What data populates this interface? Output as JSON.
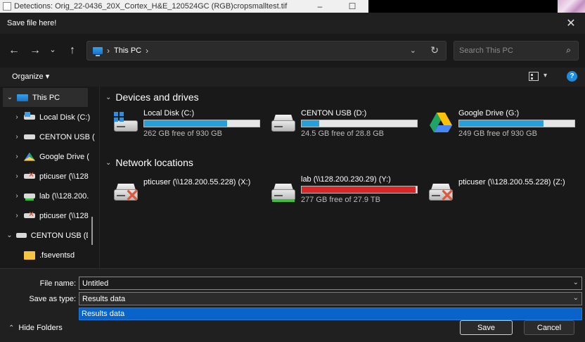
{
  "background_window": {
    "title": "Detections: Orig_22-0436_20X_Cortex_H&E_120524GC (RGB)cropsmalltest.tif",
    "minimize": "–",
    "maximize": "☐"
  },
  "dialog": {
    "title": "Save file here!",
    "close": "✕"
  },
  "nav": {
    "back": "←",
    "forward": "→",
    "recent": "⌄",
    "up": "↑",
    "address": {
      "crumbs": [
        "This PC"
      ],
      "separator": "›",
      "dropdown": "⌄",
      "refresh": "↻"
    },
    "search_placeholder": "Search This PC",
    "search_icon": "⌕"
  },
  "command_bar": {
    "organize_label": "Organize ▾",
    "view_dropdown": "▾",
    "help": "?"
  },
  "sidebar": {
    "items": [
      {
        "chevron": "⌄",
        "label": "This PC",
        "icon": "pc-icon",
        "selected": true
      },
      {
        "chevron": "›",
        "label": "Local Disk (C:)",
        "icon": "local-disk-icon"
      },
      {
        "chevron": "›",
        "label": "CENTON USB (",
        "icon": "usb-drive-icon"
      },
      {
        "chevron": "›",
        "label": "Google Drive (",
        "icon": "google-drive-icon"
      },
      {
        "chevron": "›",
        "label": "pticuser (\\\\128",
        "icon": "disconnected-network-drive-icon"
      },
      {
        "chevron": "›",
        "label": "lab (\\\\128.200.",
        "icon": "network-drive-icon"
      },
      {
        "chevron": "›",
        "label": "pticuser (\\\\128",
        "icon": "disconnected-network-drive-icon"
      },
      {
        "chevron": "⌄",
        "label": "CENTON USB (D",
        "icon": "usb-drive-icon"
      },
      {
        "chevron": "",
        "label": ".fseventsd",
        "icon": "folder-icon"
      }
    ]
  },
  "main": {
    "devices_header": "Devices and drives",
    "network_header": "Network locations",
    "group_chevron": "⌄",
    "devices": [
      {
        "name": "Local Disk (C:)",
        "free_text": "262 GB free of 930 GB",
        "used_fraction": 0.72,
        "icon": "windows-drive-icon"
      },
      {
        "name": "CENTON USB (D:)",
        "free_text": "24.5 GB free of 28.8 GB",
        "used_fraction": 0.15,
        "icon": "usb-drive-icon"
      },
      {
        "name": "Google Drive (G:)",
        "free_text": "249 GB free of 930 GB",
        "used_fraction": 0.73,
        "icon": "google-drive-icon"
      }
    ],
    "network": [
      {
        "name": "pticuser (\\\\128.200.55.228) (X:)",
        "icon": "disconnected-network-drive-icon"
      },
      {
        "name": "lab (\\\\128.200.230.29) (Y:)",
        "free_text": "277 GB free of 27.9 TB",
        "used_fraction": 0.99,
        "bar_color": "#da2626",
        "icon": "network-drive-icon"
      },
      {
        "name": "pticuser (\\\\128.200.55.228) (Z:)",
        "icon": "disconnected-network-drive-icon"
      }
    ]
  },
  "bottom": {
    "file_name_label": "File name:",
    "file_name_value": "Untitled",
    "save_type_label": "Save as type:",
    "save_type_value": "Results data",
    "dropdown_option": "Results data",
    "dropdown_arrow": "⌄",
    "hide_folders_label": "Hide Folders",
    "hide_folders_chevron": "⌃",
    "save_label": "Save",
    "cancel_label": "Cancel"
  },
  "colors": {
    "accent": "#26a0da",
    "selection": "#0a63c8",
    "critical": "#da2626"
  }
}
